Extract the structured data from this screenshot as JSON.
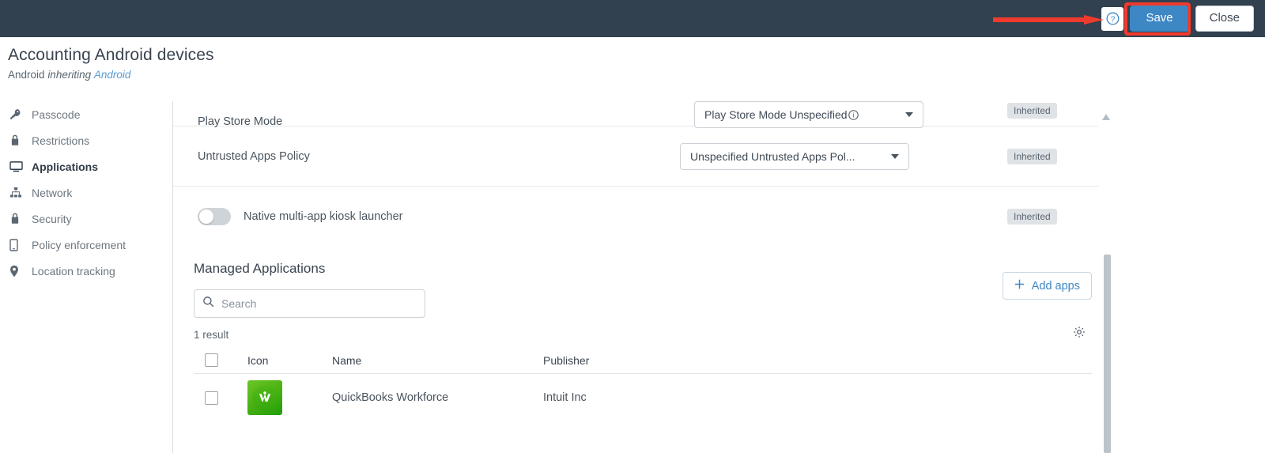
{
  "topbar": {
    "help_label": "?",
    "help_icon": "question-circle-icon",
    "save_label": "Save",
    "close_label": "Close",
    "save_accent": "#3d87c4",
    "bar_color": "#32414f",
    "annotation_color": "#f03a2e"
  },
  "header": {
    "title": "Accounting Android devices",
    "platform": "Android",
    "inheriting_word": "inheriting",
    "inherits_from": "Android"
  },
  "sidebar": {
    "items": [
      {
        "label": "Passcode",
        "icon": "key-icon",
        "active": false
      },
      {
        "label": "Restrictions",
        "icon": "lock-icon",
        "active": false
      },
      {
        "label": "Applications",
        "icon": "monitor-icon",
        "active": true
      },
      {
        "label": "Network",
        "icon": "sitemap-icon",
        "active": false
      },
      {
        "label": "Security",
        "icon": "lock-icon",
        "active": false
      },
      {
        "label": "Policy enforcement",
        "icon": "mobile-phone-icon",
        "active": false
      },
      {
        "label": "Location tracking",
        "icon": "location-pin-icon",
        "active": false
      }
    ]
  },
  "settings_rows": [
    {
      "label": "Play Store Mode",
      "value": "Play Store Mode Unspecified",
      "has_info_icon": true,
      "badge": "Inherited"
    },
    {
      "label": "Untrusted Apps Policy",
      "value": "Unspecified Untrusted Apps Pol...",
      "has_info_icon": false,
      "badge": "Inherited"
    }
  ],
  "toggle_row": {
    "label": "Native multi-app kiosk launcher",
    "state": "off",
    "badge": "Inherited"
  },
  "managed_applications": {
    "section_title": "Managed Applications",
    "search_placeholder": "Search",
    "search_value": "",
    "search_icon": "search-icon",
    "result_count": "1 result",
    "add_apps_label": "Add apps",
    "add_apps_icon": "plus-icon",
    "settings_icon": "gear-icon",
    "columns": [
      "",
      "Icon",
      "Name",
      "Publisher"
    ],
    "rows": [
      {
        "checked": false,
        "icon": "quickbooks-workforce-app-icon",
        "icon_color": "#3aa80d",
        "name": "QuickBooks Workforce",
        "publisher": "Intuit Inc"
      }
    ]
  },
  "scrollbars": {
    "vertical_thumb": "content-scrollbar-thumb",
    "scroll_up_arrow": "scroll-up-arrow"
  }
}
